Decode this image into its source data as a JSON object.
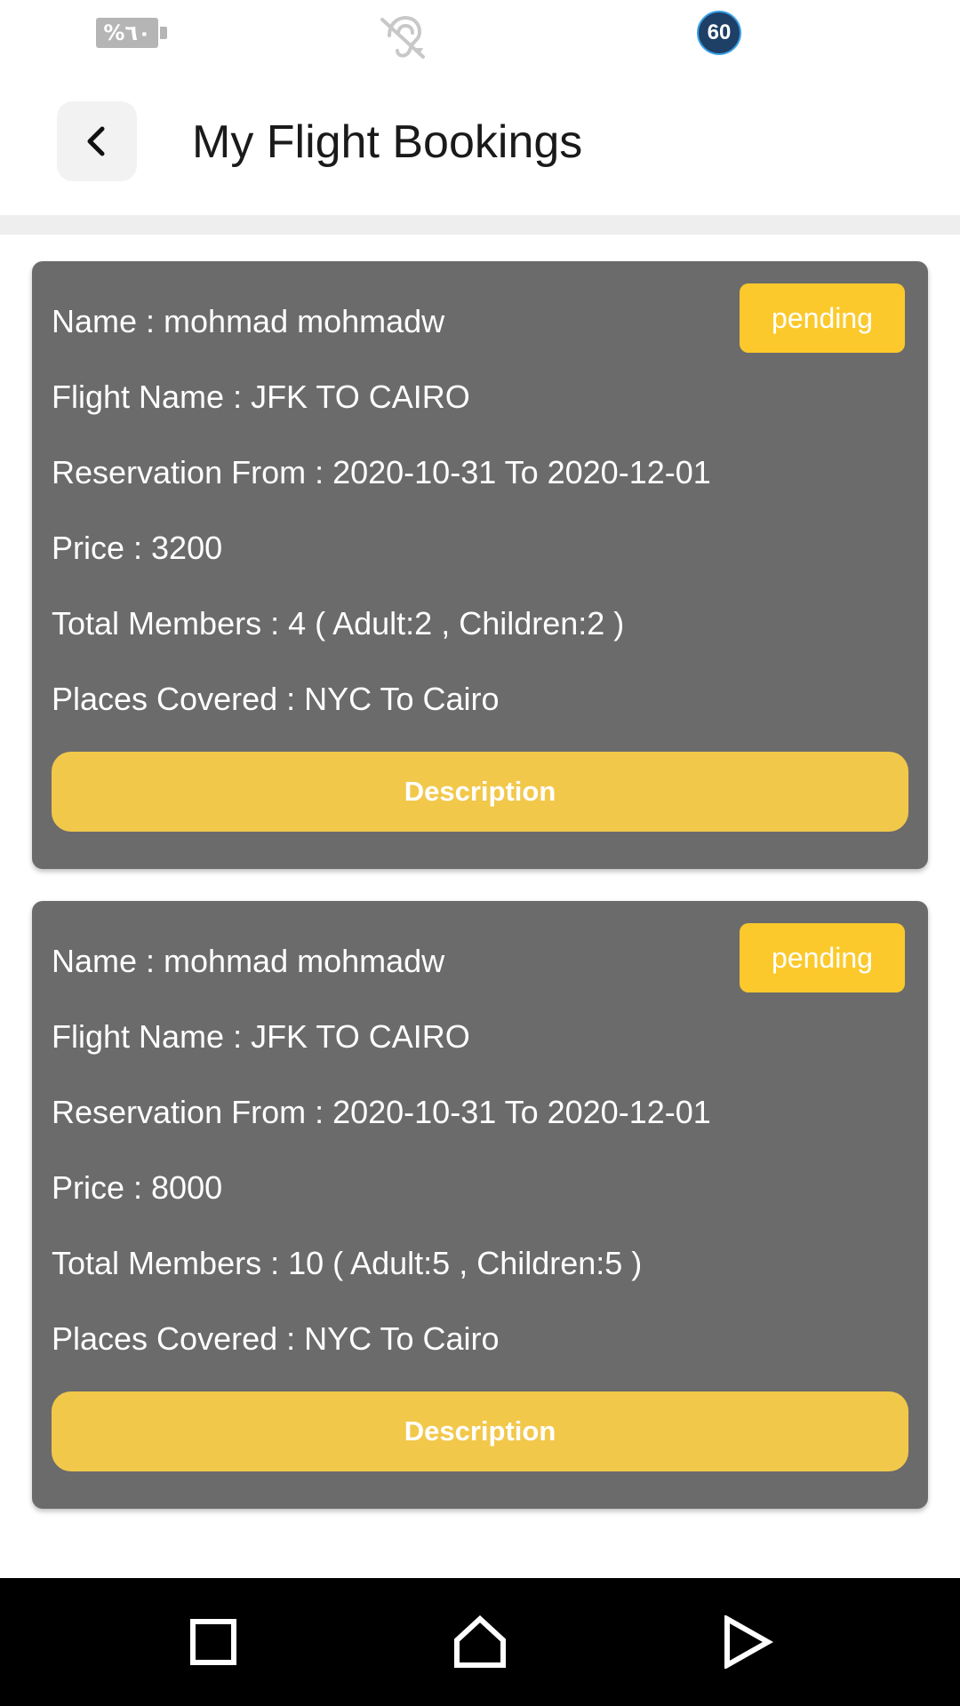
{
  "status_bar": {
    "battery_text": "%٦٠",
    "hearing_icon": "hearing-aid-icon",
    "fps_badge": "60"
  },
  "app_bar": {
    "back_icon": "chevron-left-icon",
    "title": "My Flight Bookings"
  },
  "bookings": [
    {
      "status": "pending",
      "name": "Name : mohmad mohmadw",
      "flight_name": "Flight Name : JFK TO CAIRO",
      "reservation": "Reservation From : 2020-10-31 To 2020-12-01",
      "price": "Price : 3200",
      "members": "Total Members : 4 ( Adult:2 , Children:2 )",
      "places": "Places Covered : NYC To Cairo",
      "button_label": "Description"
    },
    {
      "status": "pending",
      "name": "Name : mohmad mohmadw",
      "flight_name": "Flight Name : JFK TO CAIRO",
      "reservation": "Reservation From : 2020-10-31 To 2020-12-01",
      "price": "Price : 8000",
      "members": "Total Members : 10 ( Adult:5 , Children:5 )",
      "places": "Places Covered : NYC To Cairo",
      "button_label": "Description"
    }
  ],
  "nav_bar": {
    "recent_icon": "square-recent-apps-icon",
    "home_icon": "home-icon",
    "back_icon": "triangle-back-icon"
  },
  "colors": {
    "card_background": "#6b6b6b",
    "badge_yellow": "#fbc92c",
    "button_yellow": "#f2c84b",
    "divider_band": "#eeeeee",
    "nav_bar": "#000000"
  }
}
